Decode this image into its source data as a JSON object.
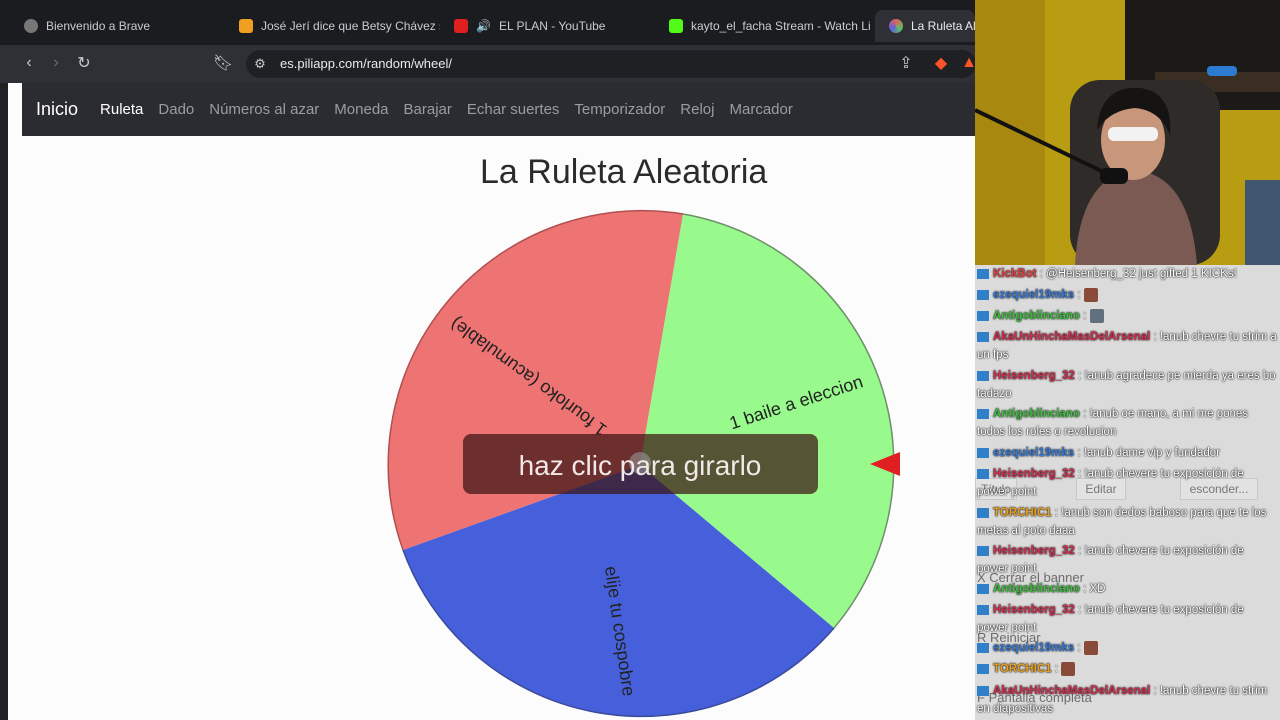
{
  "browser": {
    "tabs": [
      {
        "title": "Bienvenido a Brave"
      },
      {
        "title": "José Jerí dice que Betsy Chávez s"
      },
      {
        "title": "EL PLAN - YouTube"
      },
      {
        "title": "kayto_el_facha Stream - Watch Liv"
      },
      {
        "title": "La Ruleta Alea"
      }
    ],
    "address": "es.piliapp.com/random/wheel/",
    "colors": {
      "tab_bg": "#1b1c1f",
      "toolbar_bg": "#2e3035"
    }
  },
  "site": {
    "brand": "Inicio",
    "nav": [
      "Ruleta",
      "Dado",
      "Números al azar",
      "Moneda",
      "Barajar",
      "Echar suertes",
      "Temporizador",
      "Reloj",
      "Marcador"
    ],
    "active_nav": "Ruleta",
    "page_title": "La Ruleta Aleatoria"
  },
  "wheel": {
    "segments": [
      {
        "label": "1 baile a eleccion",
        "color": "#98f98c"
      },
      {
        "label": "elije tu cospobre",
        "color": "#4660dc"
      },
      {
        "label": "1 fourloko (acumulable)",
        "color": "#ee7373"
      }
    ],
    "spin_prompt": "haz clic para girarlo",
    "pointer_color": "#e02020"
  },
  "chat": {
    "messages": [
      {
        "user": "KickBot",
        "color": "#e04040",
        "text": ": @Heisenberg_32 just gifted 1 KICKs!"
      },
      {
        "user": "ezequiel19mks",
        "color": "#3a7bd5",
        "text": ":",
        "emote": true
      },
      {
        "user": "Antigoblinciano",
        "color": "#3fbf3f",
        "text": ":",
        "emote": true
      },
      {
        "user": "AkaUnHinchaMasDelArsenal",
        "color": "#d03050",
        "text": ": !anub chevre tu strim a un fps"
      },
      {
        "user": "Heisenberg_32",
        "color": "#d03050",
        "text": ": !anub agradece pe mierda ya eres bo tadazo"
      },
      {
        "user": "Antigoblinciano",
        "color": "#3fbf3f",
        "text": ": !anub oe mano, a mi me pones todos los roles o revolucion"
      },
      {
        "user": "ezequiel19mks",
        "color": "#3a7bd5",
        "text": ": !anub dame vip y fundador"
      },
      {
        "user": "Heisenberg_32",
        "color": "#d03050",
        "text": ": !anub chevere tu exposición de power point"
      },
      {
        "user": "TORCHIC1",
        "color": "#e8a020",
        "text": ": !anub son dedos baboso para que te los metas al poto daaa"
      },
      {
        "user": "Heisenberg_32",
        "color": "#d03050",
        "text": ": !anub chevere tu exposición de power point"
      },
      {
        "user": "Antigoblinciano",
        "color": "#3fbf3f",
        "text": ": XD"
      },
      {
        "user": "Heisenberg_32",
        "color": "#d03050",
        "text": ": !anub chevere tu exposición de power point"
      },
      {
        "user": "ezequiel19mks",
        "color": "#3a7bd5",
        "text": ":",
        "emote": true
      },
      {
        "user": "TORCHIC1",
        "color": "#e8a020",
        "text": ":",
        "emote": true
      },
      {
        "user": "AkaUnHinchaMasDelArsenal",
        "color": "#d03050",
        "text": ": !anub chevre tu strim en diapositivas"
      }
    ],
    "ghost": {
      "titulo": "Título",
      "editar": "Editar",
      "esconder": "esconder...",
      "cerrar_banner": "Cerrar el banner",
      "reiniciar": "Reiniciar",
      "pantalla_completa": "Pantalla completa"
    }
  }
}
